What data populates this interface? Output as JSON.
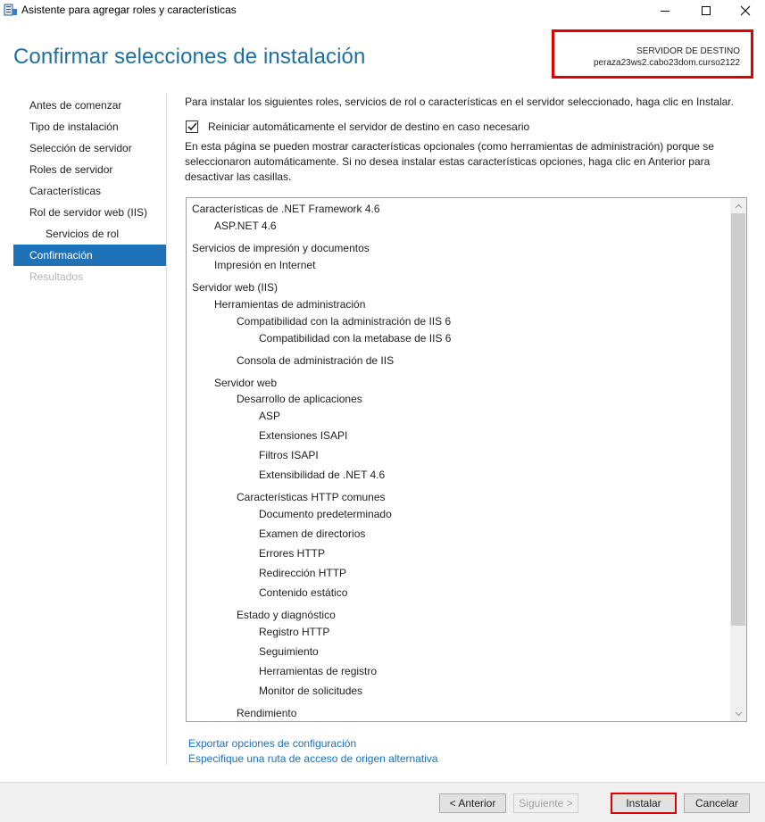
{
  "window": {
    "title": "Asistente para agregar roles y características",
    "app_icon": "server-manager-icon"
  },
  "header": {
    "title": "Confirmar selecciones de instalación",
    "destination_label": "SERVIDOR DE DESTINO",
    "destination_server": "peraza23ws2.cabo23dom.curso2122",
    "highlight_color": "#e00000"
  },
  "sidebar": {
    "items": [
      {
        "label": "Antes de comenzar",
        "state": "normal"
      },
      {
        "label": "Tipo de instalación",
        "state": "normal"
      },
      {
        "label": "Selección de servidor",
        "state": "normal"
      },
      {
        "label": "Roles de servidor",
        "state": "normal"
      },
      {
        "label": "Características",
        "state": "normal"
      },
      {
        "label": "Rol de servidor web (IIS)",
        "state": "normal"
      },
      {
        "label": "Servicios de rol",
        "state": "sub"
      },
      {
        "label": "Confirmación",
        "state": "active"
      },
      {
        "label": "Resultados",
        "state": "disabled"
      }
    ],
    "active_color": "#1e72b8"
  },
  "main": {
    "intro": "Para instalar los siguientes roles, servicios de rol o características en el servidor seleccionado, haga clic en Instalar.",
    "restart_checkbox": {
      "label": "Reiniciar automáticamente el servidor de destino en caso necesario",
      "checked": true
    },
    "optional_note": "En esta página se pueden mostrar características opcionales (como herramientas de administración) porque se seleccionaron automáticamente. Si no desea instalar estas características opciones, haga clic en Anterior para desactivar las casillas.",
    "selections": [
      {
        "text": "Características de .NET Framework 4.6",
        "level": 0
      },
      {
        "text": "ASP.NET 4.6",
        "level": 1
      },
      {
        "text": "Servicios de impresión y documentos",
        "level": 0
      },
      {
        "text": "Impresión en Internet",
        "level": 1
      },
      {
        "text": "Servidor web (IIS)",
        "level": 0
      },
      {
        "text": "Herramientas de administración",
        "level": 1
      },
      {
        "text": "Compatibilidad con la administración de IIS 6",
        "level": 2
      },
      {
        "text": "Compatibilidad con la metabase de IIS 6",
        "level": 3
      },
      {
        "text": "Consola de administración de IIS",
        "level": 2
      },
      {
        "text": "Servidor web",
        "level": 1
      },
      {
        "text": "Desarrollo de aplicaciones",
        "level": 2
      },
      {
        "text": "ASP",
        "level": 3
      },
      {
        "text": "Extensiones ISAPI",
        "level": 3
      },
      {
        "text": "Filtros ISAPI",
        "level": 3
      },
      {
        "text": "Extensibilidad de .NET 4.6",
        "level": 3
      },
      {
        "text": "Características HTTP comunes",
        "level": 2
      },
      {
        "text": "Documento predeterminado",
        "level": 3
      },
      {
        "text": "Examen de directorios",
        "level": 3
      },
      {
        "text": "Errores HTTP",
        "level": 3
      },
      {
        "text": "Redirección HTTP",
        "level": 3
      },
      {
        "text": "Contenido estático",
        "level": 3
      },
      {
        "text": "Estado y diagnóstico",
        "level": 2
      },
      {
        "text": "Registro HTTP",
        "level": 3
      },
      {
        "text": "Seguimiento",
        "level": 3
      },
      {
        "text": "Herramientas de registro",
        "level": 3
      },
      {
        "text": "Monitor de solicitudes",
        "level": 3
      },
      {
        "text": "Rendimiento",
        "level": 2
      }
    ],
    "links": {
      "export": "Exportar opciones de configuración",
      "source_path": "Especifique una ruta de acceso de origen alternativa"
    }
  },
  "footer": {
    "prev": "< Anterior",
    "next": "Siguiente >",
    "install": "Instalar",
    "cancel": "Cancelar"
  }
}
